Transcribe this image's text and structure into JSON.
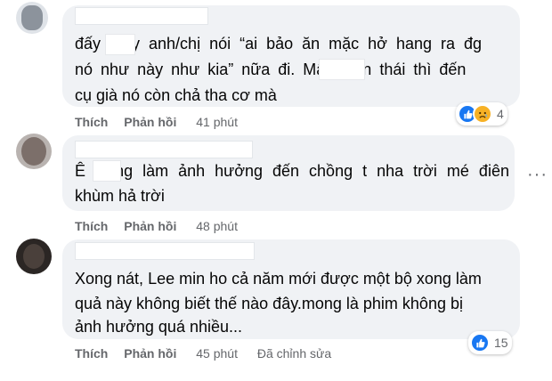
{
  "colors": {
    "bubble": "#f0f2f5",
    "text": "#050505",
    "meta": "#65676b",
    "like": "#1877f2",
    "sad": "#f7b125"
  },
  "comments": [
    {
      "lines": [
        "đấy mấy anh/chị nói “ai bảo ăn mặc hở hang ra đg",
        "nó như này như kia” nữa đi. Mấy biến thái thì đến",
        "cụ già nó còn chả tha cơ mà"
      ],
      "like_label": "Thích",
      "reply_label": "Phản hồi",
      "time": "41 phút",
      "reaction_icons": [
        "like-icon",
        "sad-icon"
      ],
      "reaction_count": "4"
    },
    {
      "lines": [
        "Ê đừng làm ảnh hưởng đến chồng t nha trời mé điên",
        "khùm hả trời"
      ],
      "like_label": "Thích",
      "reply_label": "Phản hồi",
      "time": "48 phút",
      "more_icon": "more-horizontal-icon"
    },
    {
      "lines": [
        "Xong nát, Lee min ho cả năm mới được một bộ xong làm",
        "quả này không biết thế nào đây.mong là phim không bị",
        "ảnh hưởng quá nhiều..."
      ],
      "like_label": "Thích",
      "reply_label": "Phản hồi",
      "time": "45 phút",
      "edited": "Đã chỉnh sửa",
      "reaction_icons": [
        "like-icon"
      ],
      "reaction_count": "15"
    }
  ]
}
